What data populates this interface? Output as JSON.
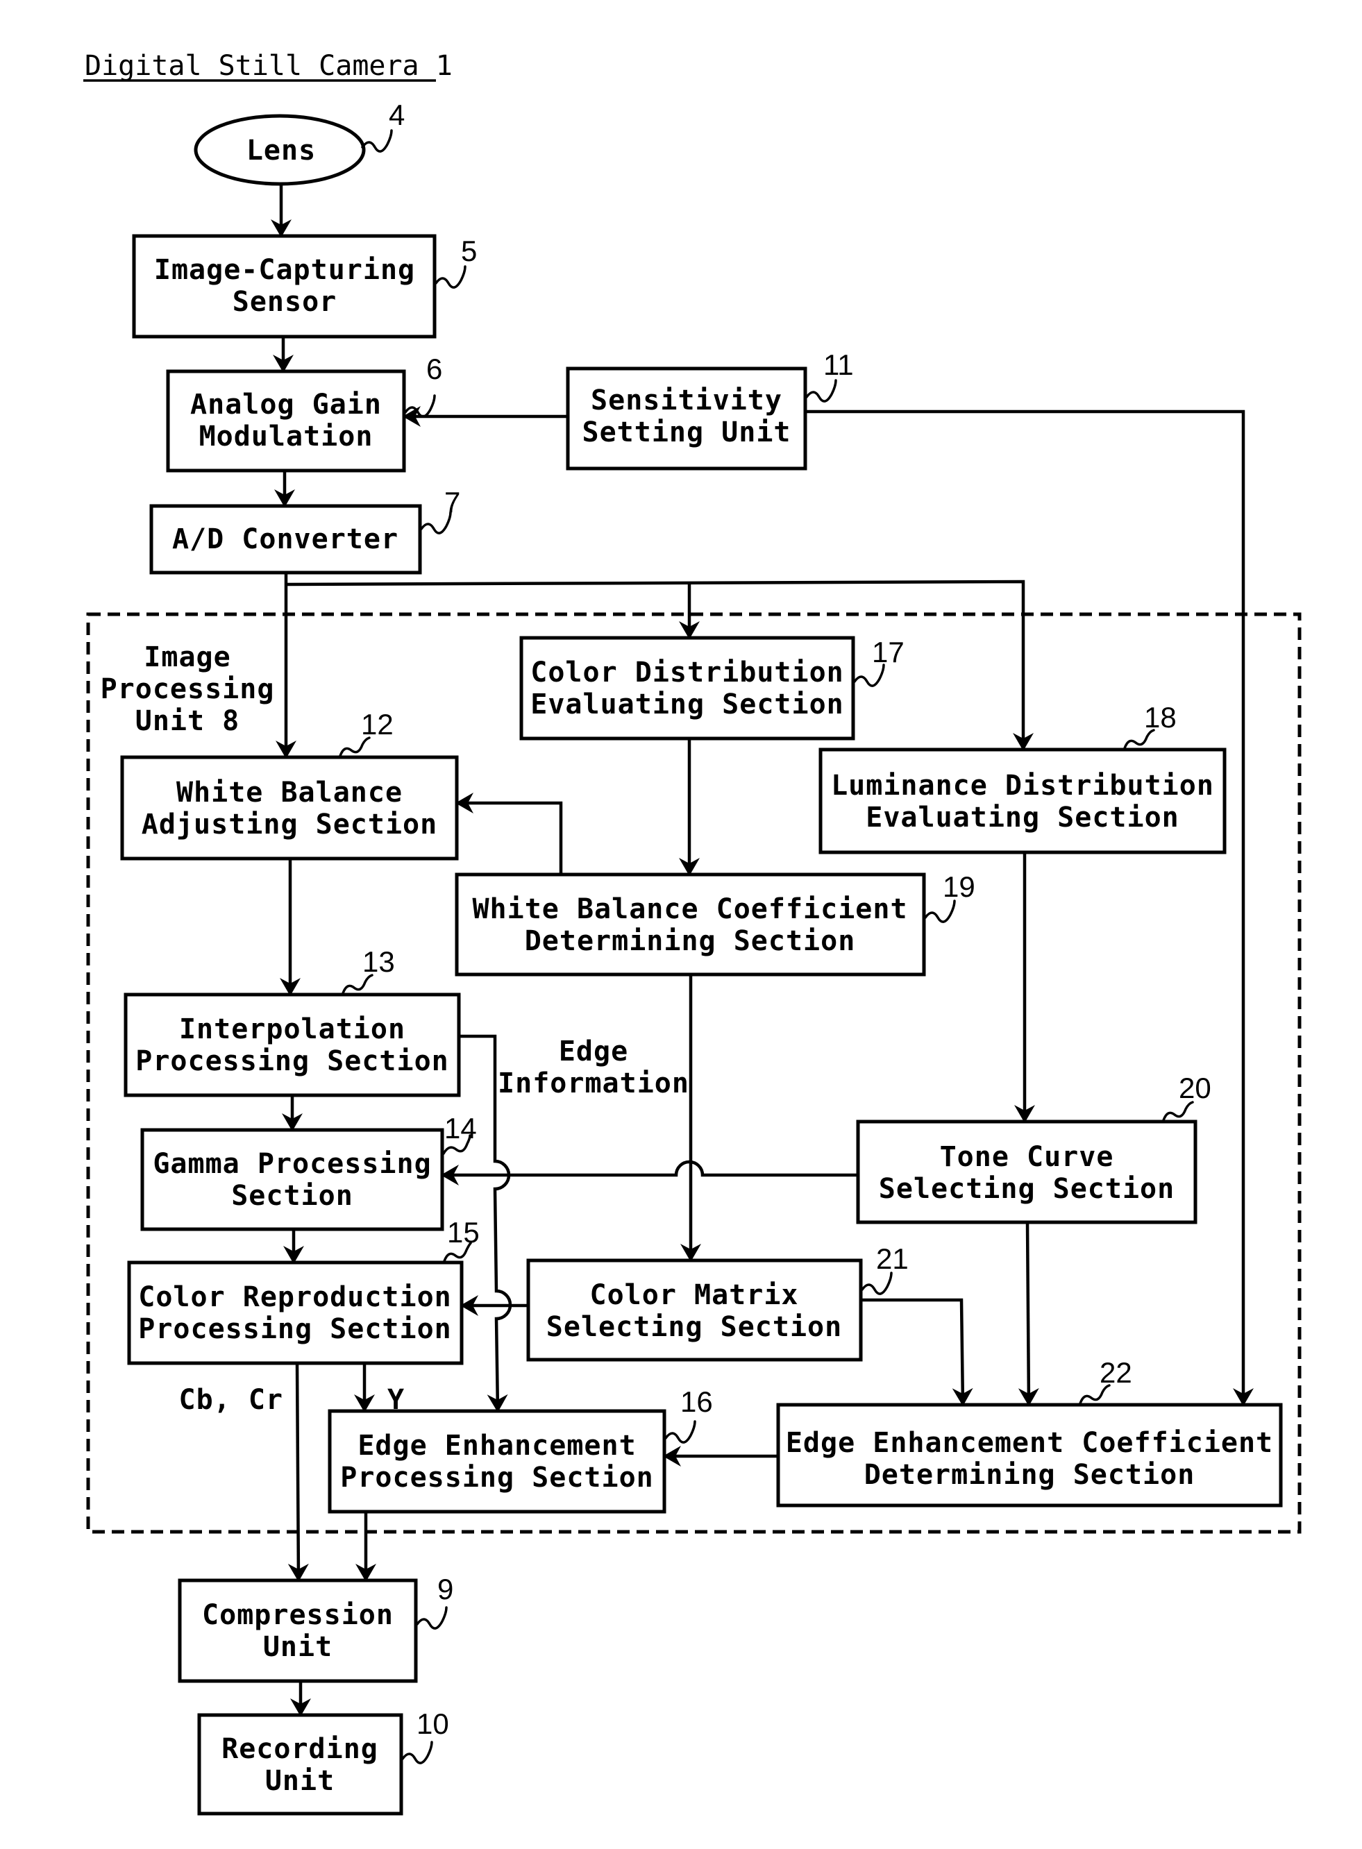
{
  "title": "Digital Still Camera 1",
  "unit_label": {
    "lines": [
      "Image",
      "Processing",
      "Unit 8"
    ]
  },
  "blocks": {
    "lens": {
      "ref": "4",
      "lines": [
        "Lens"
      ]
    },
    "sensor": {
      "ref": "5",
      "lines": [
        "Image-Capturing",
        "Sensor"
      ]
    },
    "analog_gain": {
      "ref": "6",
      "lines": [
        "Analog Gain",
        "Modulation"
      ]
    },
    "ad_converter": {
      "ref": "7",
      "lines": [
        "A/D Converter"
      ]
    },
    "sensitivity": {
      "ref": "11",
      "lines": [
        "Sensitivity",
        "Setting Unit"
      ]
    },
    "wb_adjust": {
      "ref": "12",
      "lines": [
        "White Balance",
        "Adjusting Section"
      ]
    },
    "interpolation": {
      "ref": "13",
      "lines": [
        "Interpolation",
        "Processing Section"
      ]
    },
    "gamma": {
      "ref": "14",
      "lines": [
        "Gamma Processing",
        "Section"
      ]
    },
    "color_repro": {
      "ref": "15",
      "lines": [
        "Color Reproduction",
        "Processing Section"
      ]
    },
    "edge_proc": {
      "ref": "16",
      "lines": [
        "Edge Enhancement",
        "Processing Section"
      ]
    },
    "color_dist": {
      "ref": "17",
      "lines": [
        "Color Distribution",
        "Evaluating Section"
      ]
    },
    "lum_dist": {
      "ref": "18",
      "lines": [
        "Luminance Distribution",
        "Evaluating Section"
      ]
    },
    "wb_coef": {
      "ref": "19",
      "lines": [
        "White Balance Coefficient",
        "Determining Section"
      ]
    },
    "tone_curve": {
      "ref": "20",
      "lines": [
        "Tone Curve",
        "Selecting Section"
      ]
    },
    "color_matrix": {
      "ref": "21",
      "lines": [
        "Color Matrix",
        "Selecting Section"
      ]
    },
    "edge_coef": {
      "ref": "22",
      "lines": [
        "Edge Enhancement Coefficient",
        "Determining Section"
      ]
    },
    "compression": {
      "ref": "9",
      "lines": [
        "Compression",
        "Unit"
      ]
    },
    "recording": {
      "ref": "10",
      "lines": [
        "Recording",
        "Unit"
      ]
    }
  },
  "annotations": {
    "edge_information": [
      "Edge",
      "Information"
    ],
    "cbcr": "Cb, Cr",
    "y": "Y"
  }
}
